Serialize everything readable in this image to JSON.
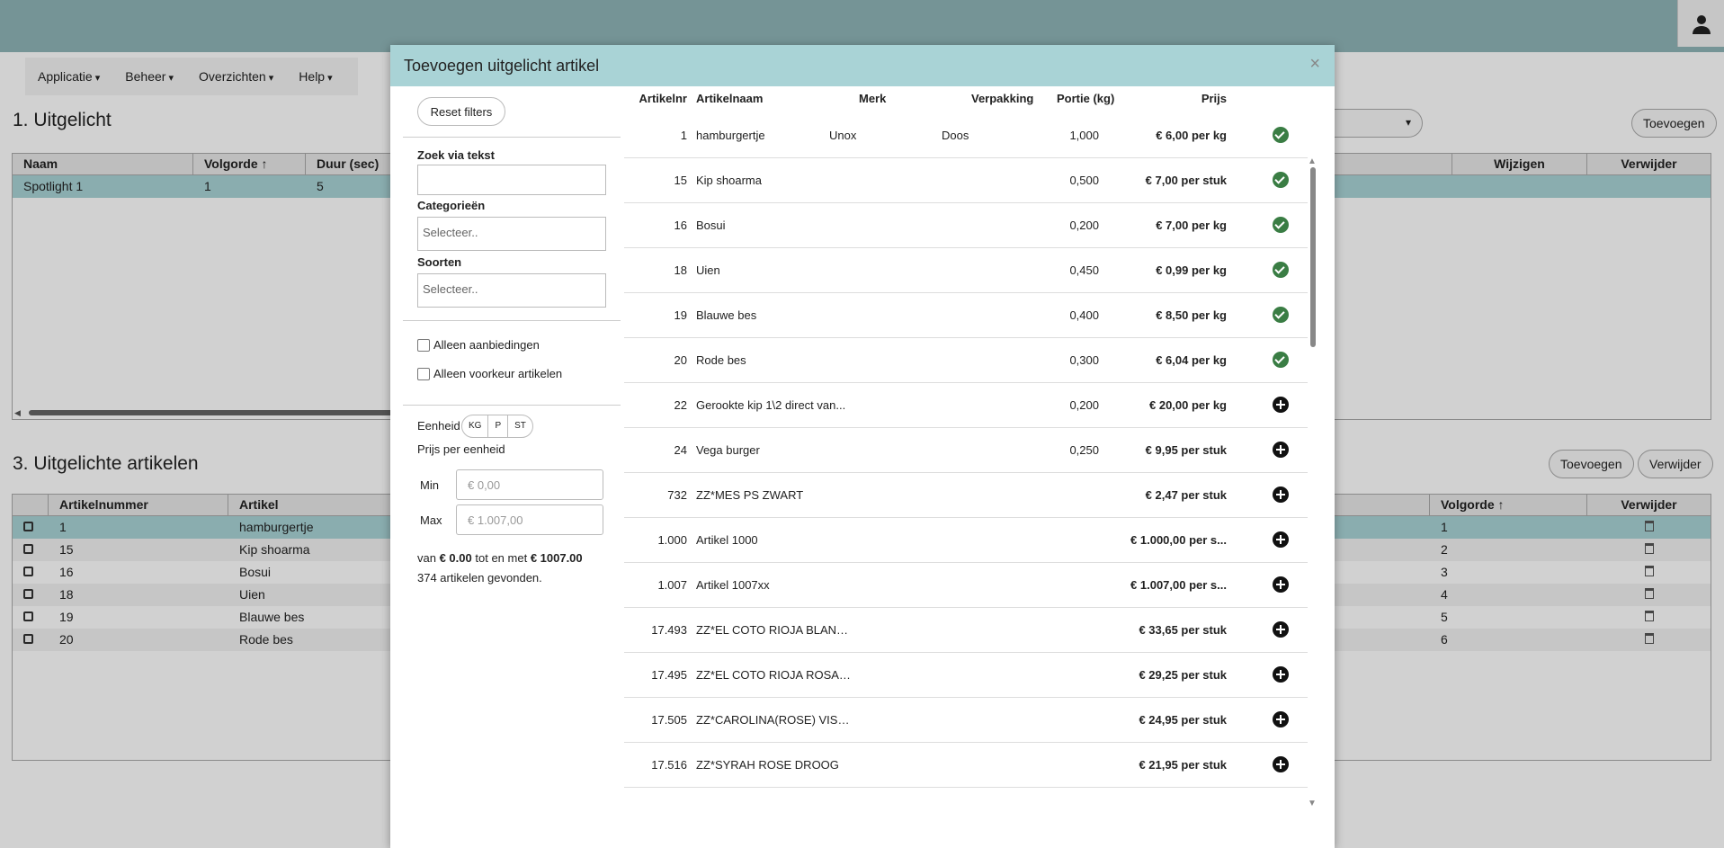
{
  "nav": {
    "items": [
      "Applicatie",
      "Beheer",
      "Overzichten",
      "Help"
    ]
  },
  "section1": {
    "title": "1. Uitgelicht",
    "add_label": "Toevoegen",
    "columns": [
      "Naam",
      "Volgorde ↑",
      "Duur (sec)",
      "Wijzigen",
      "Verwijder"
    ],
    "rows": [
      {
        "naam": "Spotlight 1",
        "volgorde": "1",
        "duur": "5"
      }
    ]
  },
  "section3": {
    "title": "3. Uitgelichte artikelen",
    "add_label": "Toevoegen",
    "delete_label": "Verwijder",
    "columns": [
      "Artikelnummer",
      "Artikel",
      "Volgorde ↑",
      "Verwijder"
    ],
    "rows": [
      {
        "nr": "1",
        "artikel": "hamburgertje",
        "volgorde": "1"
      },
      {
        "nr": "15",
        "artikel": "Kip shoarma",
        "volgorde": "2"
      },
      {
        "nr": "16",
        "artikel": "Bosui",
        "volgorde": "3"
      },
      {
        "nr": "18",
        "artikel": "Uien",
        "volgorde": "4"
      },
      {
        "nr": "19",
        "artikel": "Blauwe bes",
        "volgorde": "5"
      },
      {
        "nr": "20",
        "artikel": "Rode bes",
        "volgorde": "6"
      }
    ]
  },
  "modal": {
    "title": "Toevoegen uitgelicht artikel",
    "close": "×",
    "filters": {
      "reset_label": "Reset filters",
      "search_label": "Zoek via tekst",
      "search_value": "",
      "categories_label": "Categorieën",
      "categories_placeholder": "Selecteer..",
      "sorts_label": "Soorten",
      "sorts_placeholder": "Selecteer..",
      "only_offers": "Alleen aanbiedingen",
      "only_preferred": "Alleen voorkeur artikelen",
      "unit_label": "Eenheid",
      "units": [
        "KG",
        "P",
        "ST"
      ],
      "price_per_unit": "Prijs per eenheid",
      "min_label": "Min",
      "min_placeholder": "€ 0,00",
      "max_label": "Max",
      "max_placeholder": "€ 1.007,00",
      "range_van": "van",
      "range_min": "€ 0.00",
      "range_tot": "tot en met",
      "range_max": "€ 1007.00",
      "found_text": "374 artikelen gevonden."
    },
    "columns": {
      "nr": "Artikelnr",
      "name": "Artikelnaam",
      "merk": "Merk",
      "verpakking": "Verpakking",
      "portie": "Portie (kg)",
      "prijs": "Prijs"
    },
    "articles": [
      {
        "nr": "1",
        "name": "hamburgertje",
        "merk": "Unox",
        "verpakking": "Doos",
        "portie": "1,000",
        "prijs": "€ 6,00 per kg",
        "added": true
      },
      {
        "nr": "15",
        "name": "Kip shoarma",
        "merk": "",
        "verpakking": "",
        "portie": "0,500",
        "prijs": "€ 7,00 per stuk",
        "added": true
      },
      {
        "nr": "16",
        "name": "Bosui",
        "merk": "",
        "verpakking": "",
        "portie": "0,200",
        "prijs": "€ 7,00 per kg",
        "added": true
      },
      {
        "nr": "18",
        "name": "Uien",
        "merk": "",
        "verpakking": "",
        "portie": "0,450",
        "prijs": "€ 0,99 per kg",
        "added": true
      },
      {
        "nr": "19",
        "name": "Blauwe bes",
        "merk": "",
        "verpakking": "",
        "portie": "0,400",
        "prijs": "€ 8,50 per kg",
        "added": true
      },
      {
        "nr": "20",
        "name": "Rode bes",
        "merk": "",
        "verpakking": "",
        "portie": "0,300",
        "prijs": "€ 6,04 per kg",
        "added": true
      },
      {
        "nr": "22",
        "name": "Gerookte kip 1\\2 direct van...",
        "merk": "",
        "verpakking": "",
        "portie": "0,200",
        "prijs": "€ 20,00 per kg",
        "added": false
      },
      {
        "nr": "24",
        "name": "Vega burger",
        "merk": "",
        "verpakking": "",
        "portie": "0,250",
        "prijs": "€ 9,95 per stuk",
        "added": false
      },
      {
        "nr": "732",
        "name": "ZZ*MES PS ZWART",
        "merk": "",
        "verpakking": "",
        "portie": "",
        "prijs": "€ 2,47 per stuk",
        "added": false
      },
      {
        "nr": "1.000",
        "name": "Artikel 1000",
        "merk": "",
        "verpakking": "",
        "portie": "",
        "prijs": "€ 1.000,00 per s...",
        "added": false
      },
      {
        "nr": "1.007",
        "name": "Artikel 1007xx",
        "merk": "",
        "verpakking": "",
        "portie": "",
        "prijs": "€ 1.007,00 per s...",
        "added": false
      },
      {
        "nr": "17.493",
        "name": "ZZ*EL COTO RIOJA BLANCO",
        "merk": "",
        "verpakking": "",
        "portie": "",
        "prijs": "€ 33,65 per stuk",
        "added": false
      },
      {
        "nr": "17.495",
        "name": "ZZ*EL COTO RIOJA ROSAD...",
        "merk": "",
        "verpakking": "",
        "portie": "",
        "prijs": "€ 29,25 per stuk",
        "added": false
      },
      {
        "nr": "17.505",
        "name": "ZZ*CAROLINA(ROSE) VISTA...",
        "merk": "",
        "verpakking": "",
        "portie": "",
        "prijs": "€ 24,95 per stuk",
        "added": false
      },
      {
        "nr": "17.516",
        "name": "ZZ*SYRAH ROSE DROOG",
        "merk": "",
        "verpakking": "",
        "portie": "",
        "prijs": "€ 21,95 per stuk",
        "added": false
      }
    ]
  },
  "colors": {
    "header": "#8fb5b8",
    "modal_header": "#a9d3d6",
    "check": "#3a7d44"
  }
}
